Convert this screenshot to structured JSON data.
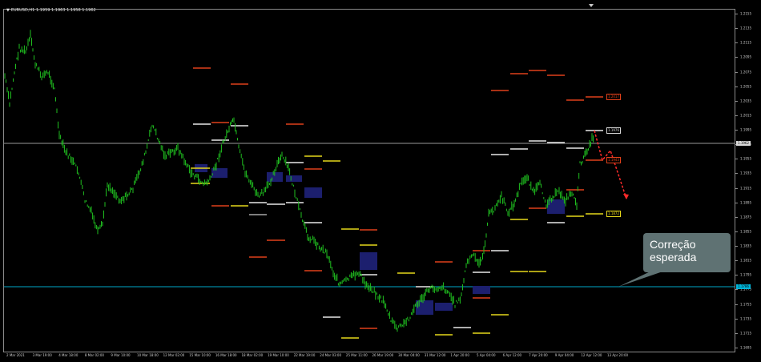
{
  "chart": {
    "title": "EURUSD,H1  1.1959 1.1963 1.1958 1.1962",
    "symbol_timeframe": "EURUSD,H1",
    "ohlc": "1.1959 1.1963 1.1958 1.1962",
    "bid_price": "1.1962",
    "cyan_level_price": "1.1786",
    "background_color": "#000000",
    "candle_color": "#1fbf1f",
    "projection_color": "#ff2a2a"
  },
  "price_axis": {
    "ticks": [
      "1.2155",
      "1.2135",
      "1.2115",
      "1.2095",
      "1.2075",
      "1.2055",
      "1.2035",
      "1.2015",
      "1.1995",
      "1.1975",
      "1.1955",
      "1.1935",
      "1.1915",
      "1.1895",
      "1.1875",
      "1.1855",
      "1.1835",
      "1.1815",
      "1.1795",
      "1.1775",
      "1.1755",
      "1.1735",
      "1.1715",
      "1.1695"
    ]
  },
  "time_axis": {
    "ticks": [
      "2 Mar 2021",
      "3 Mar 19:00",
      "4 Mar 18:00",
      "8 Mar 02:00",
      "9 Mar 10:00",
      "10 Mar 18:00",
      "12 Mar 02:00",
      "15 Mar 10:00",
      "16 Mar 18:00",
      "18 Mar 02:00",
      "19 Mar 10:00",
      "22 Mar 19:00",
      "24 Mar 03:00",
      "25 Mar 11:00",
      "26 Mar 19:00",
      "30 Mar 04:00",
      "31 Mar 12:00",
      "1 Apr 20:00",
      "5 Apr 04:00",
      "6 Apr 12:00",
      "7 Apr 20:00",
      "9 Apr 04:00",
      "12 Apr 12:00",
      "13 Apr 20:00"
    ]
  },
  "level_labels": [
    {
      "text": "1.2017",
      "color": "#e0401a"
    },
    {
      "text": "1.1976",
      "color": "#d8d8d8"
    },
    {
      "text": "1.1943",
      "color": "#e0401a"
    },
    {
      "text": "1.1872",
      "color": "#e6d81a"
    }
  ],
  "annotation": {
    "line1": "Correção",
    "line2": "esperada"
  }
}
